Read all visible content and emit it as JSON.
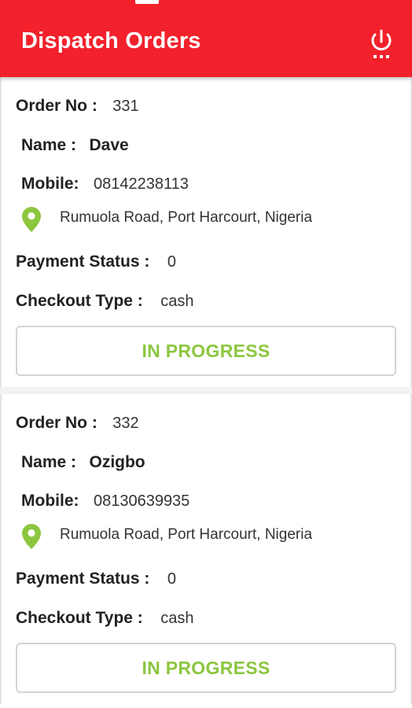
{
  "app": {
    "title": "Dispatch Orders",
    "accent_color": "#f2212b",
    "power_icon": "power-icon"
  },
  "labels": {
    "order_no": "Order No :",
    "name": "Name :",
    "mobile": "Mobile:",
    "payment_status": "Payment Status :",
    "checkout_type": "Checkout Type :"
  },
  "orders": [
    {
      "order_no": "331",
      "name": "Dave",
      "mobile": "08142238113",
      "address": "Rumuola Road, Port Harcourt, Nigeria",
      "payment_status": "0",
      "checkout_type": "cash",
      "status_button": "IN PROGRESS",
      "status_color": "#8cc63f"
    },
    {
      "order_no": "332",
      "name": "Ozigbo",
      "mobile": "08130639935",
      "address": "Rumuola Road, Port Harcourt, Nigeria",
      "payment_status": "0",
      "checkout_type": "cash",
      "status_button": "IN PROGRESS",
      "status_color": "#8cc63f"
    }
  ]
}
